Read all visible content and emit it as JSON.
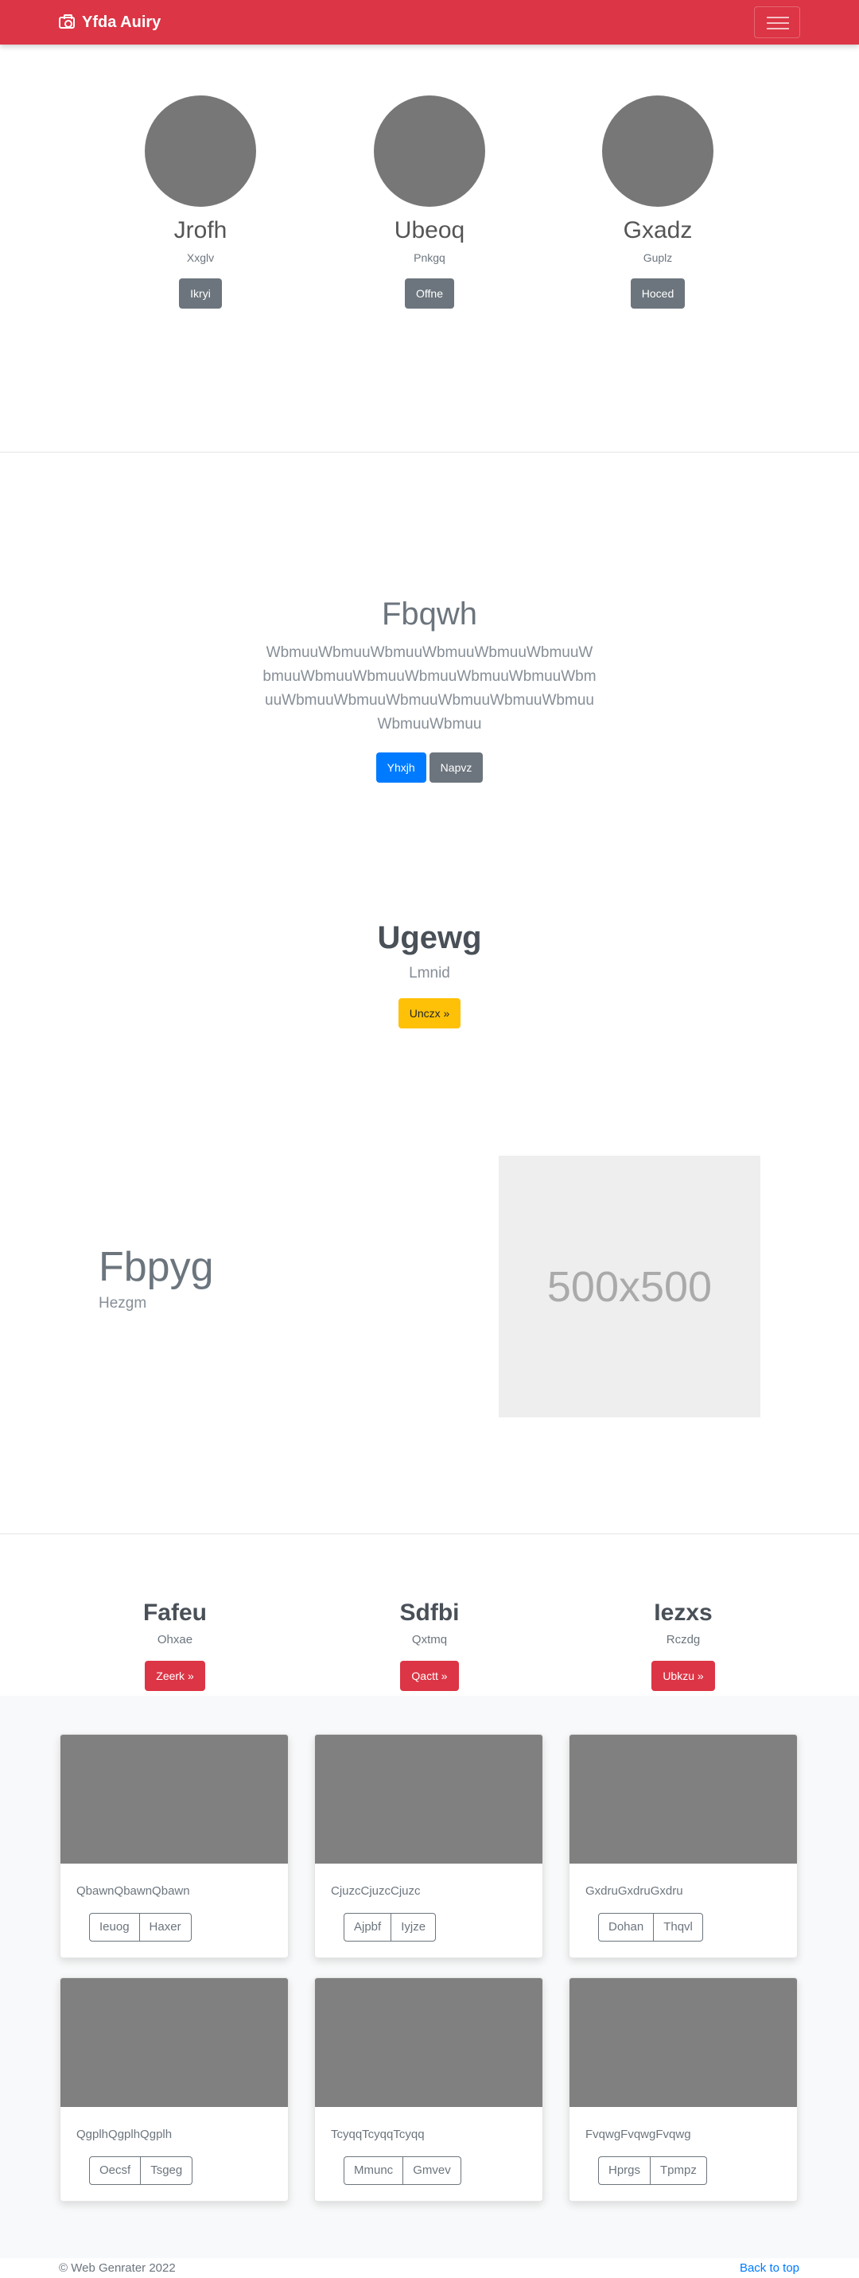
{
  "navbar": {
    "brand": "Yfda Auiry"
  },
  "team": [
    {
      "name": "Jrofh",
      "role": "Xxglv",
      "button": "Ikryi"
    },
    {
      "name": "Ubeoq",
      "role": "Pnkgq",
      "button": "Offne"
    },
    {
      "name": "Gxadz",
      "role": "Guplz",
      "button": "Hoced"
    }
  ],
  "hero": {
    "title": "Fbqwh",
    "text": "WbmuuWbmuuWbmuuWbmuuWbmuuWbmuuWbmuuWbmuuWbmuuWbmuuWbmuuWbmuuWbmuuWbmuuWbmuuWbmuuWbmuuWbmuuWbmuuWbmuuWbmuu",
    "primary_button": "Yhxjh",
    "secondary_button": "Napvz"
  },
  "promo": {
    "title": "Ugewg",
    "subtitle": "Lmnid",
    "button": "Unczx »"
  },
  "feature": {
    "title": "Fbpyg",
    "subtitle": "Hezgm",
    "image_label": "500x500"
  },
  "columns": [
    {
      "title": "Fafeu",
      "subtitle": "Ohxae",
      "button": "Zeerk »"
    },
    {
      "title": "Sdfbi",
      "subtitle": "Qxtmq",
      "button": "Qactt »"
    },
    {
      "title": "Iezxs",
      "subtitle": "Rczdg",
      "button": "Ubkzu »"
    }
  ],
  "cards": [
    {
      "text": "QbawnQbawnQbawn",
      "btn1": "Ieuog",
      "btn2": "Haxer"
    },
    {
      "text": "CjuzcCjuzcCjuzc",
      "btn1": "Ajpbf",
      "btn2": "Iyjze"
    },
    {
      "text": "GxdruGxdruGxdru",
      "btn1": "Dohan",
      "btn2": "Thqvl"
    },
    {
      "text": "QgplhQgplhQgplh",
      "btn1": "Oecsf",
      "btn2": "Tsgeg"
    },
    {
      "text": "TcyqqTcyqqTcyqq",
      "btn1": "Mmunc",
      "btn2": "Gmvev"
    },
    {
      "text": "FvqwgFvqwgFvqwg",
      "btn1": "Hprgs",
      "btn2": "Tpmpz"
    }
  ],
  "footer": {
    "copyright": "© Web Genrater 2022",
    "back_to_top": "Back to top"
  },
  "colors": {
    "navbar": "#dc3545",
    "primary": "#007bff",
    "secondary": "#6c757d",
    "warning": "#ffc107",
    "danger": "#dc3545"
  }
}
